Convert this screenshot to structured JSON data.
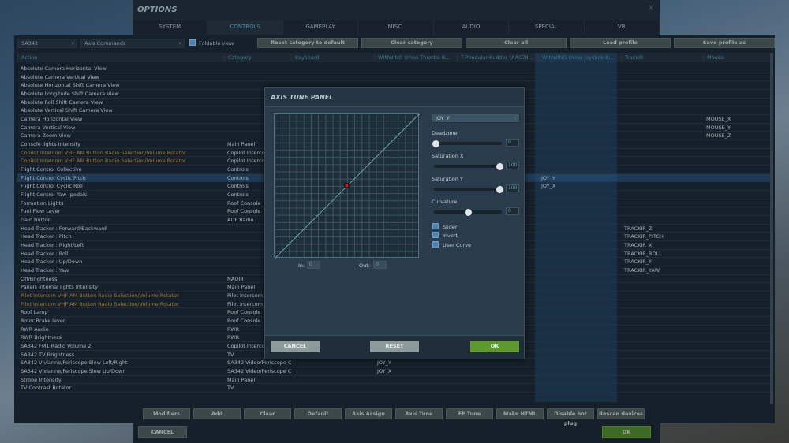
{
  "window": {
    "title": "OPTIONS",
    "close": "X"
  },
  "tabs": [
    "SYSTEM",
    "CONTROLS",
    "GAMEPLAY",
    "MISC.",
    "AUDIO",
    "SPECIAL",
    "VR"
  ],
  "active_tab": "CONTROLS",
  "toolbar": {
    "aircraft": "SA342",
    "category": "Axis Commands",
    "foldable_label": "Foldable view",
    "buttons": [
      "Reset category to default",
      "Clear category",
      "Clear all",
      "Load profile",
      "Save profile as"
    ]
  },
  "columns": [
    "Action",
    "Category",
    "Keyboard",
    "WINWING Orion Throttle B...",
    "T-Pendular-Rudder (AAC78...",
    "WINWING Orion Joystick B...",
    "TrackIR",
    "Mouse"
  ],
  "rows": [
    {
      "a": "Absolute Camera Horizontal View"
    },
    {
      "a": "Absolute Camera Vertical View"
    },
    {
      "a": "Absolute Horizontal Shift Camera View"
    },
    {
      "a": "Absolute Longitude Shift Camera View"
    },
    {
      "a": "Absolute Roll Shift Camera View"
    },
    {
      "a": "Absolute Vertical Shift Camera View"
    },
    {
      "a": "Camera Horizontal View",
      "mouse": "MOUSE_X"
    },
    {
      "a": "Camera Vertical View",
      "mouse": "MOUSE_Y"
    },
    {
      "a": "Camera Zoom View",
      "mouse": "MOUSE_Z"
    },
    {
      "a": "Console lights Intensity",
      "c": "Main Panel"
    },
    {
      "a": "Copilot Intercom VHF AM Button Radio Selection/Volume Rotator",
      "c": "Copilot Intercom",
      "orange": true
    },
    {
      "a": "Copilot Intercom VHF AM Button Radio Selection/Volume Rotator",
      "c": "Copilot Intercom",
      "orange": true
    },
    {
      "a": "Flight Control Collective",
      "c": "Controls"
    },
    {
      "a": "Flight Control Cyclic Pitch",
      "c": "Controls",
      "joy": "JOY_Y",
      "selected": true
    },
    {
      "a": "Flight Control Cyclic Roll",
      "c": "Controls",
      "joy": "JOY_X"
    },
    {
      "a": "Flight Control Yaw (pedals)",
      "c": "Controls"
    },
    {
      "a": "Formation Lights",
      "c": "Roof Console"
    },
    {
      "a": "Fuel Flow Lever",
      "c": "Roof Console"
    },
    {
      "a": "Gain Button",
      "c": "ADF Radio"
    },
    {
      "a": "Head Tracker : Forward/Backward",
      "trackir": "TRACKIR_Z"
    },
    {
      "a": "Head Tracker : Pitch",
      "trackir": "TRACKIR_PITCH"
    },
    {
      "a": "Head Tracker : Right/Left",
      "trackir": "TRACKIR_X"
    },
    {
      "a": "Head Tracker : Roll",
      "trackir": "TRACKIR_ROLL"
    },
    {
      "a": "Head Tracker : Up/Down",
      "trackir": "TRACKIR_Y"
    },
    {
      "a": "Head Tracker : Yaw",
      "trackir": "TRACKIR_YAW"
    },
    {
      "a": "Off/Brightness",
      "c": "NADIR"
    },
    {
      "a": "Panels internal lights Intensity",
      "c": "Main Panel"
    },
    {
      "a": "Pilot Intercom VHF AM Button Radio Selection/Volume Rotator",
      "c": "Pilot Intercom",
      "orange": true
    },
    {
      "a": "Pilot Intercom VHF AM Button Radio Selection/Volume Rotator",
      "c": "Pilot Intercom",
      "orange": true
    },
    {
      "a": "Roof Lamp",
      "c": "Roof Console"
    },
    {
      "a": "Rotor Brake lever",
      "c": "Roof Console"
    },
    {
      "a": "RWR Audio",
      "c": "RWR"
    },
    {
      "a": "RWR Brightness",
      "c": "RWR"
    },
    {
      "a": "SA342 FM1 Radio Volume 2",
      "c": "Copilot Intercom"
    },
    {
      "a": "SA342 TV Brightness",
      "c": "TV"
    },
    {
      "a": "SA342 Vivianne/Periscope Slew Left/Right",
      "c": "SA342 Video/Periscope Co",
      "throttle": "JOY_Y"
    },
    {
      "a": "SA342 Vivianne/Periscope Slew Up/Down",
      "c": "SA342 Video/Periscope Co",
      "throttle": "JOY_X"
    },
    {
      "a": "Strobe Intensity",
      "c": "Main Panel"
    },
    {
      "a": "TV Contrast Rotator",
      "c": "TV"
    }
  ],
  "action_buttons": [
    "Modifiers",
    "Add",
    "Clear",
    "Default",
    "Axis Assign",
    "Axis Tune",
    "FF Tune",
    "Make HTML",
    "Disable hot plug",
    "Rescan devices"
  ],
  "footer": {
    "cancel": "CANCEL",
    "ok": "OK"
  },
  "axis_panel": {
    "title": "AXIS TUNE PANEL",
    "axis": "JOY_Y",
    "deadzone": {
      "label": "Deadzone",
      "value": "0"
    },
    "saturation_x": {
      "label": "Saturation X",
      "value": "100"
    },
    "saturation_y": {
      "label": "Saturation Y",
      "value": "100"
    },
    "curvature": {
      "label": "Curvature",
      "value": "0"
    },
    "checkboxes": [
      "Slider",
      "Invert",
      "User Curve"
    ],
    "in_label": "In:",
    "in_value": "0",
    "out_label": "Out:",
    "out_value": "0",
    "buttons": {
      "cancel": "CANCEL",
      "reset": "RESET",
      "ok": "OK"
    }
  },
  "colors": {
    "accent": "#3f8fa8",
    "ok_green": "#4c7a2a",
    "highlight_orange": "#a5772a"
  }
}
